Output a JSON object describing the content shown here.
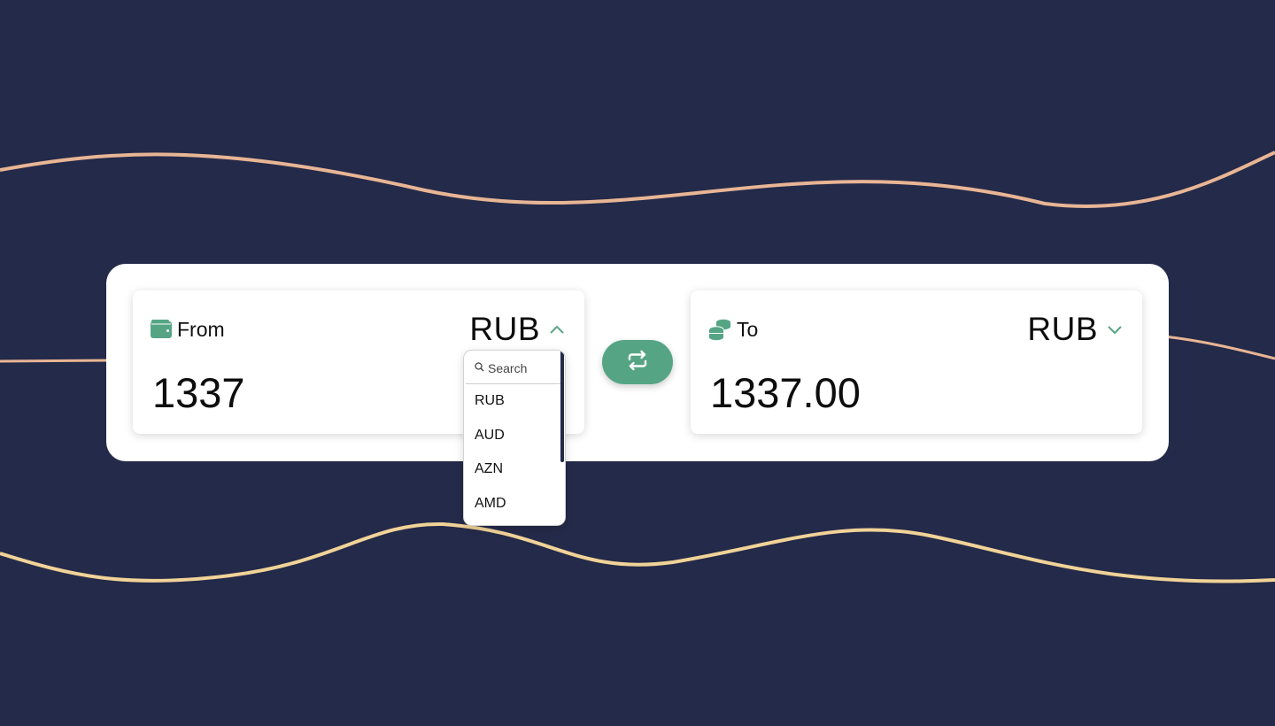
{
  "from": {
    "label": "From",
    "icon": "wallet-icon",
    "currency": "RUB",
    "amount": "1337",
    "dropdown_open": true
  },
  "to": {
    "label": "To",
    "icon": "coins-icon",
    "currency": "RUB",
    "amount": "1337.00"
  },
  "swap": {
    "icon": "swap-arrows-icon"
  },
  "dropdown": {
    "search_placeholder": "Search",
    "options": [
      "RUB",
      "AUD",
      "AZN",
      "AMD"
    ]
  },
  "colors": {
    "background": "#242a49",
    "accent": "#55a585",
    "wave_top": "#e8b595",
    "wave_bottom": "#f1d398"
  }
}
